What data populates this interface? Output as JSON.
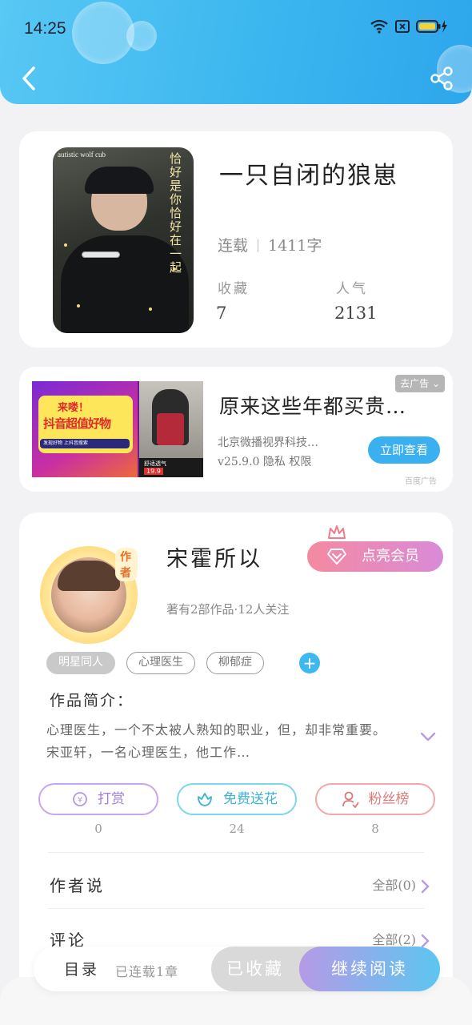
{
  "status_bar": {
    "time": "14:25",
    "battery_icon": "battery-charging-icon",
    "wifi_icon": "wifi-icon"
  },
  "header": {
    "back_icon": "back-arrow-icon",
    "share_icon": "share-icon"
  },
  "book": {
    "cover_text_top": "autistic wolf cub",
    "cover_text_side": "恰好是你恰好在一起",
    "title": "一只自闭的狼崽",
    "status": "连载",
    "word_count": "1411字",
    "stats": [
      {
        "label": "收藏",
        "value": "7"
      },
      {
        "label": "人气",
        "value": "2131"
      }
    ]
  },
  "ad": {
    "image_text_1": "来喽！",
    "image_text_2": "抖音超值好物",
    "image_text_3": "发现好物 上抖音搜索",
    "image_text_4": "舒适透气",
    "image_text_5": "19.9",
    "title": "原来这些年都买贵…",
    "close_label": "去广告",
    "company": "北京微播视界科技…",
    "info": "v25.9.0  隐私  权限",
    "cta": "立即查看",
    "source": "百度广告"
  },
  "author": {
    "badge": "作者",
    "name": "宋霍所以",
    "vip_button": "点亮会员",
    "meta": "著有2部作品·12人关注",
    "tags": [
      "明星同人",
      "心理医生",
      "柳郁症"
    ],
    "intro_title": "作品简介：",
    "intro_text": "心理医生，一个不太被人熟知的职业，但，却非常重要。宋亚轩，一名心理医生，他工作…",
    "actions": [
      {
        "label": "打赏",
        "count": "0",
        "icon": "coin-icon"
      },
      {
        "label": "免费送花",
        "count": "24",
        "icon": "flower-icon"
      },
      {
        "label": "粉丝榜",
        "count": "8",
        "icon": "user-icon"
      }
    ],
    "author_says": {
      "title": "作者说",
      "link": "全部(0)"
    },
    "comments": {
      "title": "评论",
      "link": "全部(2)"
    }
  },
  "bottom_bar": {
    "toc_label": "目录",
    "toc_sub": "已连载1章",
    "collected_label": "已收藏",
    "continue_label": "继续阅读"
  },
  "colors": {
    "accent_blue": "#3ab0f0",
    "vip_pink": "#f48aa0",
    "purple": "#b59ae6"
  }
}
